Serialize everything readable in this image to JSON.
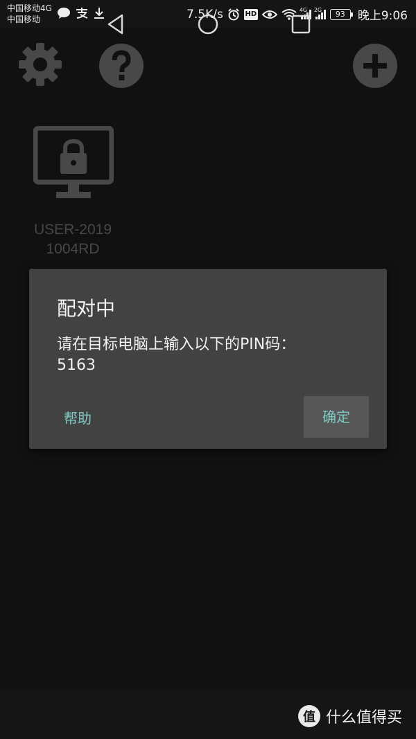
{
  "status_bar": {
    "carrier_line1": "中国移动4G",
    "carrier_line2": "中国移动",
    "net_speed": "7.5K/s",
    "hd_label": "HD",
    "net_4g": "4G",
    "net_2g": "2G",
    "battery": "93",
    "time": "晚上9:06",
    "icons": [
      "chat-icon",
      "alipay-icon",
      "download-icon",
      "alarm-icon",
      "hd-icon",
      "eye-icon",
      "wifi-icon",
      "signal-icon",
      "battery-icon"
    ]
  },
  "toolbar": {
    "icons": [
      "settings-icon",
      "help-icon",
      "add-icon"
    ]
  },
  "computer": {
    "name_line1": "USER-2019",
    "name_line2": "1004RD",
    "icon": "locked-monitor-icon"
  },
  "dialog": {
    "title": "配对中",
    "message": "请在目标电脑上输入以下的PIN码：",
    "pin": "5163",
    "help_label": "帮助",
    "confirm_label": "确定"
  },
  "nav_bar": {
    "icons": [
      "back-icon",
      "home-icon",
      "recents-icon"
    ]
  },
  "watermark": {
    "badge": "值",
    "text": "什么值得买"
  },
  "colors": {
    "background": "#1b1b1b",
    "dialog": "#424242",
    "accent": "#7fcbc4",
    "icon_gray": "#6f6f6f"
  }
}
